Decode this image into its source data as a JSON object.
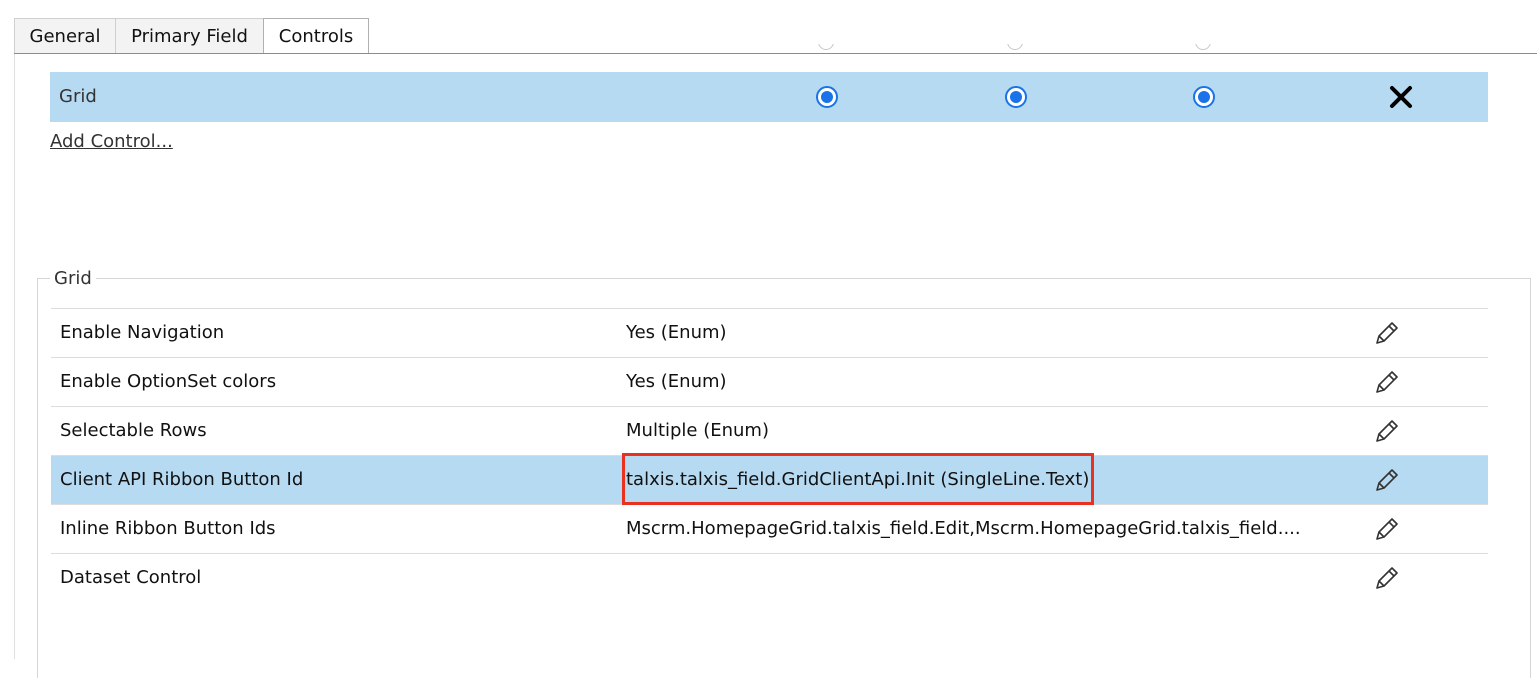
{
  "tabs": [
    {
      "label": "General",
      "active": false
    },
    {
      "label": "Primary Field",
      "active": false
    },
    {
      "label": "Controls",
      "active": true
    }
  ],
  "controls": {
    "rows": [
      {
        "name": "Grid",
        "web": true,
        "phone": true,
        "tablet": true
      }
    ],
    "add_link": "Add Control..."
  },
  "grid_section": {
    "legend": "Grid",
    "properties": [
      {
        "name": "Enable Navigation",
        "value": "Yes (Enum)"
      },
      {
        "name": "Enable OptionSet colors",
        "value": "Yes (Enum)"
      },
      {
        "name": "Selectable Rows",
        "value": "Multiple (Enum)"
      },
      {
        "name": "Client API Ribbon Button Id",
        "value": "talxis.talxis_field.GridClientApi.Init (SingleLine.Text)",
        "selected": true
      },
      {
        "name": "Inline Ribbon Button Ids",
        "value": "Mscrm.HomepageGrid.talxis_field.Edit,Mscrm.HomepageGrid.talxis_field...."
      },
      {
        "name": "Dataset Control",
        "value": ""
      }
    ]
  },
  "colors": {
    "selection": "#b6daf2",
    "radio": "#1a73e8",
    "highlight": "#e8321f"
  },
  "icons": {
    "remove": "close-icon",
    "edit": "pencil-icon"
  }
}
